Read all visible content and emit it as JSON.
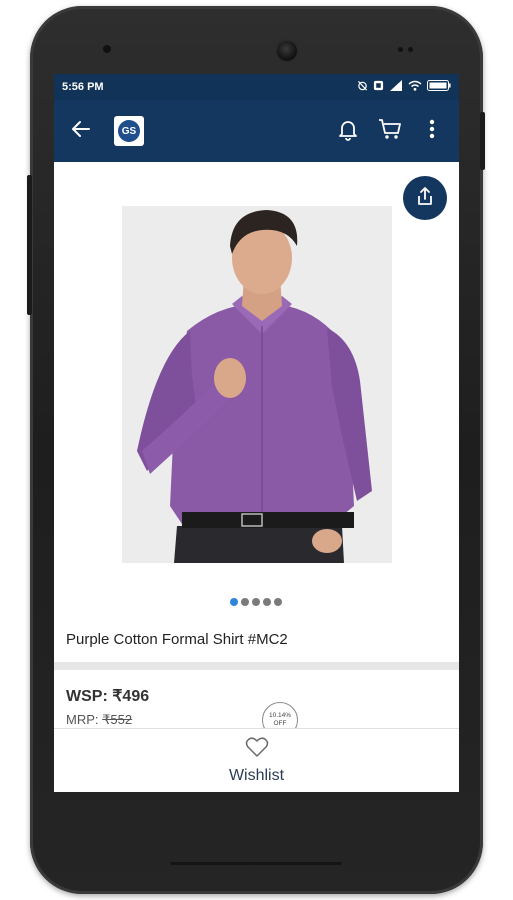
{
  "status_bar": {
    "time": "5:56 PM",
    "icons": [
      "alarm-off-icon",
      "screenshot-icon",
      "signal-icon",
      "wifi-icon",
      "battery-icon"
    ]
  },
  "app_bar": {
    "logo_text": "GS",
    "icons": [
      "back-arrow-icon",
      "bell-icon",
      "cart-icon",
      "more-vert-icon"
    ]
  },
  "product": {
    "title": "Purple Cotton Formal Shirt #MC2",
    "image_dots": 5,
    "active_dot": 0,
    "wsp_label": "WSP:",
    "wsp_value": "₹496",
    "mrp_label": "MRP:",
    "mrp_value": "₹552",
    "discount_value": "10.14%",
    "discount_label": "OFF"
  },
  "bottom_bar": {
    "wishlist_label": "Wishlist"
  },
  "colors": {
    "app_bar": "#14375f",
    "status_bar": "#123358",
    "active_dot": "#2f86d8",
    "shirt": "#8a5aa6"
  }
}
